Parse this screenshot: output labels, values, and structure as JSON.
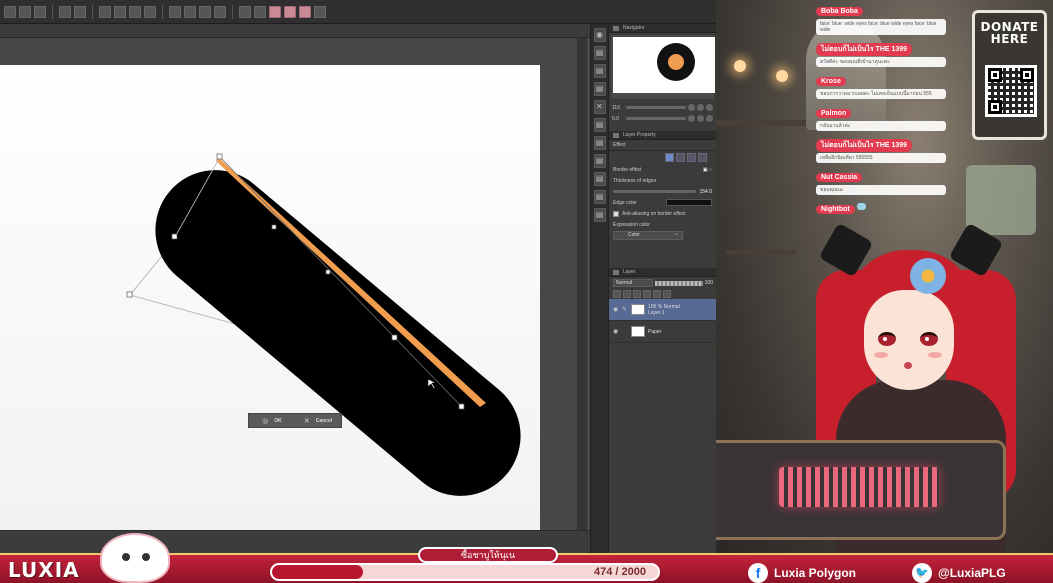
{
  "navigator": {
    "tab_label": "Navigator"
  },
  "layer_property": {
    "tab_label": "Layer Property",
    "section_label": "Effect",
    "border_effect_label": "Border effect",
    "thickness_label": "Thickness of edges",
    "thickness_value": "154.0",
    "edge_color_label": "Edge color",
    "antialias_label": "Anti-aliasing on border effect",
    "expression_color_label": "Expression color",
    "expression_color_value": "Color"
  },
  "layers": {
    "tab_label": "Layer",
    "blend_mode": "Normal",
    "opacity": "100",
    "items": [
      {
        "line1": "100 % Normal",
        "line2": "Layer 1",
        "selected": true
      },
      {
        "line1": "Paper",
        "line2": "",
        "selected": false
      }
    ]
  },
  "transform_bar": {
    "ok_label": "OK",
    "cancel_label": "Cancel"
  },
  "chat": {
    "items": [
      {
        "user": "Boba Boba",
        "message": "face: blue: wide eyes face: blue wide eyes face: blue wide"
      },
      {
        "user": "ไม่ตอบก็ไม่เป็นไร THE 1399",
        "message": "สวัสดีค่ะ ขอบคุณที่เข้ามาดูนะคะ"
      },
      {
        "user": "Krose",
        "message": "ชอบการวาดมากเลยค่ะ ไม่เคยเห็นแบบนี้มาก่อน 555"
      },
      {
        "user": "Palmon",
        "message": "กลับมาแล้วค่ะ"
      },
      {
        "user": "ไม่ตอบก็ไม่เป็นไร THE 1399",
        "message": "เหลืออีกนิดเดียว 555555"
      },
      {
        "user": "Nut Cassia",
        "message": "ขอบคุณนะ"
      },
      {
        "user": "Nightbot",
        "message": ""
      }
    ]
  },
  "donate": {
    "line1": "DONATE",
    "line2": "HERE"
  },
  "banner": {
    "brand": "LUXIA",
    "goal_label": "ซื้อชาบูให้นุเน",
    "goal_value": "474 / 2000",
    "goal_fraction": 0.237,
    "facebook": "Luxia Polygon",
    "twitter": "@LuxiaPLG"
  },
  "colors": {
    "accent_red": "#c3243b",
    "shape_fill": "#000000",
    "stroke_orange": "#f09d50"
  }
}
